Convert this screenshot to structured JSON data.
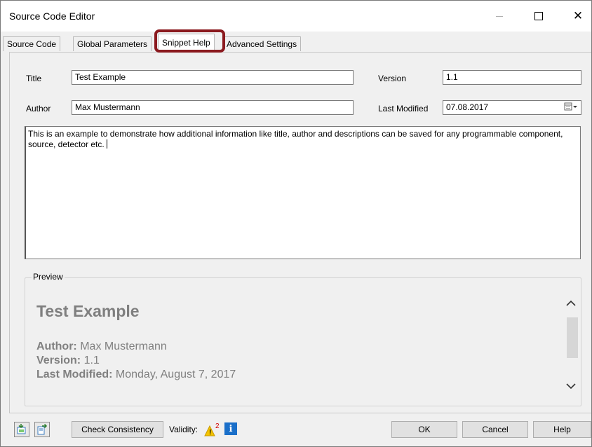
{
  "window": {
    "title": "Source Code Editor",
    "minimize_symbol": "—",
    "close_symbol": "✕"
  },
  "tabs": [
    {
      "label": "Source Code",
      "active": false
    },
    {
      "label": "Global Parameters",
      "active": false
    },
    {
      "label": "Snippet Help",
      "active": true
    },
    {
      "label": "Advanced Settings",
      "active": false
    }
  ],
  "form": {
    "title_label": "Title",
    "title_value": "Test Example",
    "author_label": "Author",
    "author_value": "Max Mustermann",
    "version_label": "Version",
    "version_value": "1.1",
    "last_modified_label": "Last Modified",
    "last_modified_value": "07.08.2017",
    "description": "This is an example to demonstrate how additional information like title, author and descriptions can be saved for any programmable component, source, detector etc."
  },
  "preview": {
    "legend": "Preview",
    "title": "Test Example",
    "author_key": "Author:",
    "author_value": "Max Mustermann",
    "version_key": "Version:",
    "version_value": "1.1",
    "last_modified_key": "Last Modified:",
    "last_modified_value": "Monday, August 7, 2017"
  },
  "bottom": {
    "check_consistency_label": "Check Consistency",
    "validity_label": "Validity:",
    "warning_count": "2",
    "info_symbol": "i",
    "ok_label": "OK",
    "cancel_label": "Cancel",
    "help_label": "Help"
  },
  "colors": {
    "highlight": "#8b1a1f",
    "warning": "#f5c400",
    "info": "#1a6fc9"
  }
}
